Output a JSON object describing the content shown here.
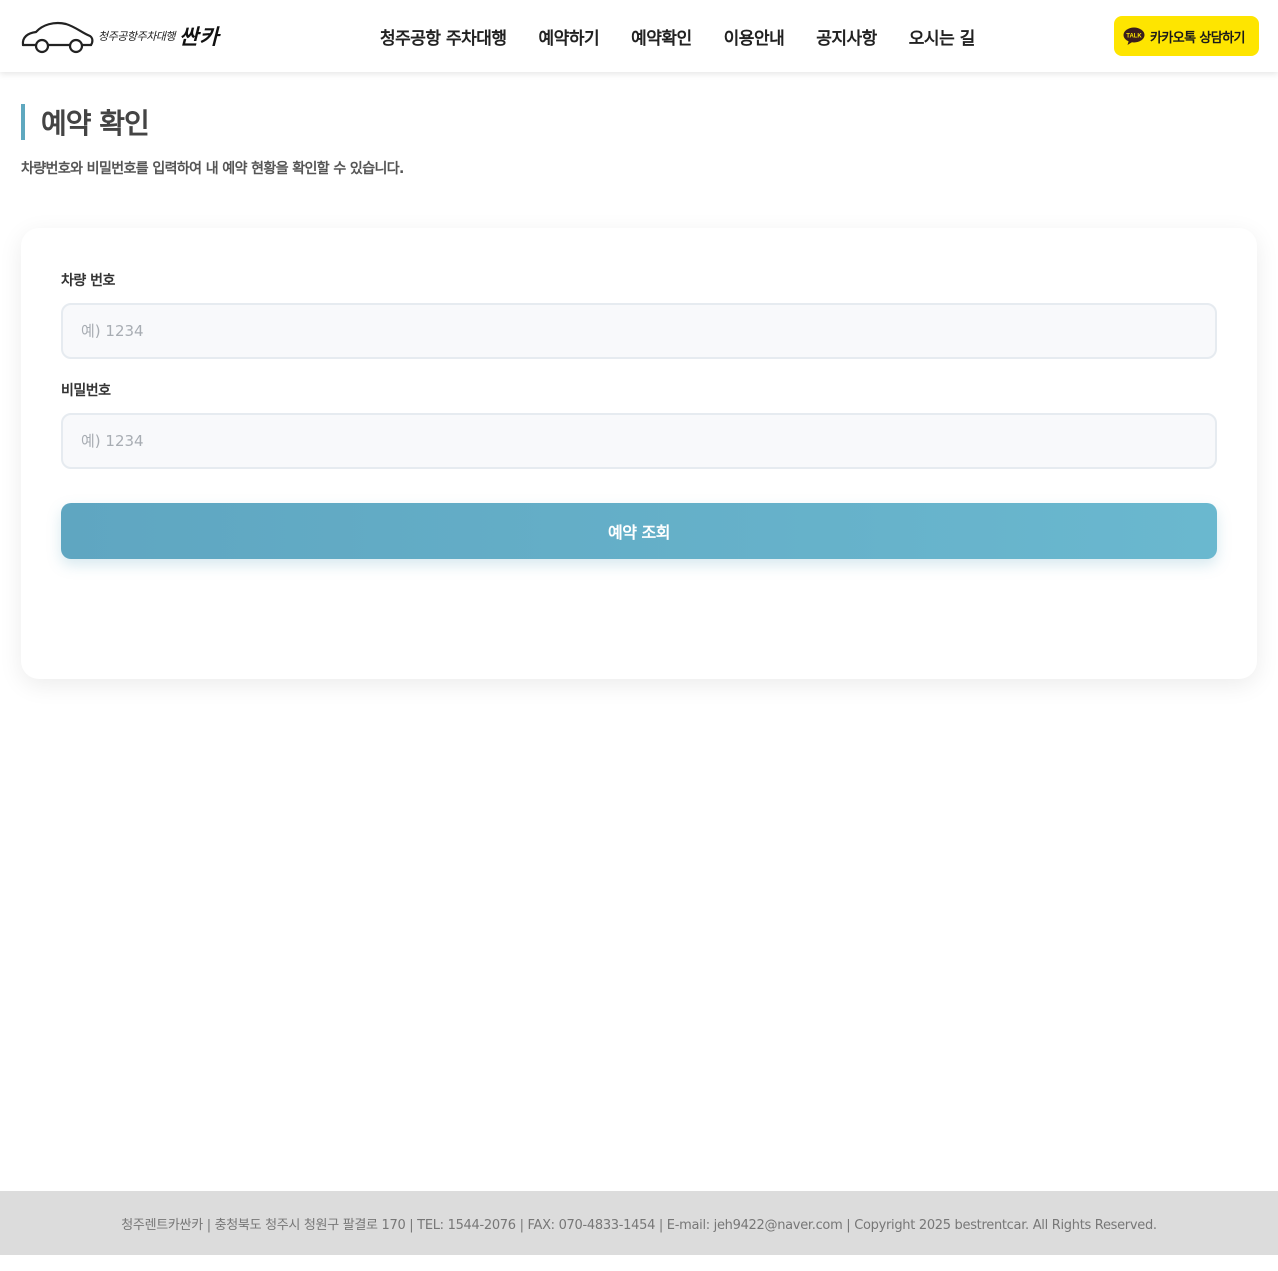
{
  "header": {
    "logo": {
      "text": "청주공항주차대행",
      "brand": "싼카",
      "icon": "car-outline-icon"
    },
    "nav": [
      {
        "label": "청주공항 주차대행"
      },
      {
        "label": "예약하기"
      },
      {
        "label": "예약확인"
      },
      {
        "label": "이용안내"
      },
      {
        "label": "공지사항"
      },
      {
        "label": "오시는 길"
      }
    ],
    "kakao": {
      "label": "카카오톡 상담하기",
      "icon": "kakaotalk-icon",
      "icon_text": "TALK",
      "color": "#fee500"
    }
  },
  "page": {
    "title": "예약 확인",
    "description": "차량번호와 비밀번호를 입력하여 내 예약 현황을 확인할 수 있습니다.",
    "accent_color": "#5fa8bf"
  },
  "form": {
    "car_number": {
      "label": "차량 번호",
      "placeholder": "예) 1234",
      "value": ""
    },
    "password": {
      "label": "비밀번호",
      "placeholder": "예) 1234",
      "value": ""
    },
    "submit_label": "예약 조회"
  },
  "footer": {
    "text": "청주렌트카싼카 | 충청북도 청주시 청원구 팔결로 170 | TEL: 1544-2076 | FAX: 070-4833-1454 | E-mail: jeh9422@naver.com | Copyright 2025 bestrentcar. All Rights Reserved."
  }
}
